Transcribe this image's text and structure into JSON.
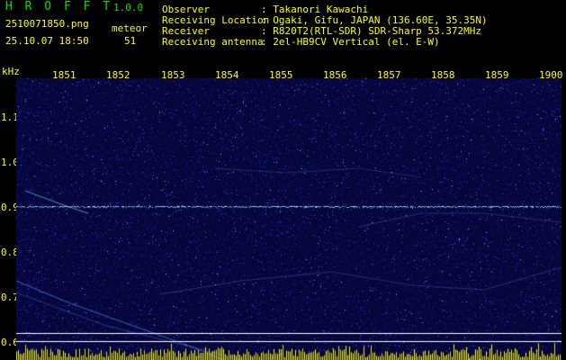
{
  "header": {
    "app_title": "H R O F F T",
    "app_version": "1.0.0",
    "file_name": "2510071850.png",
    "meteor_label": "meteor",
    "date_time": "25.10.07 18:50",
    "meteor_count": "51",
    "info": [
      {
        "label": "Observer",
        "value": ": Takanori Kawachi"
      },
      {
        "label": "Receiving Location",
        "value": ": Ogaki, Gifu, JAPAN (136.60E, 35.35N)"
      },
      {
        "label": "Receiver",
        "value": ": R820T2(RTL-SDR) SDR-Sharp 53.372MHz"
      },
      {
        "label": "Receiving antenna",
        "value": ": 2el-HB9CV Vertical (el. E-W)"
      }
    ]
  },
  "axis": {
    "unit": "kHz",
    "x_ticks": [
      "1851",
      "1852",
      "1853",
      "1854",
      "1855",
      "1856",
      "1857",
      "1858",
      "1859",
      "1900"
    ],
    "y_ticks": [
      "1.1",
      "1.0",
      "0.9",
      "0.8",
      "0.7",
      "0.6"
    ]
  },
  "colors": {
    "text_yellow": "#ffff00",
    "text_green": "#00e000",
    "noise_bg": "#0a0a5a",
    "carrier": "#80c8ff"
  }
}
